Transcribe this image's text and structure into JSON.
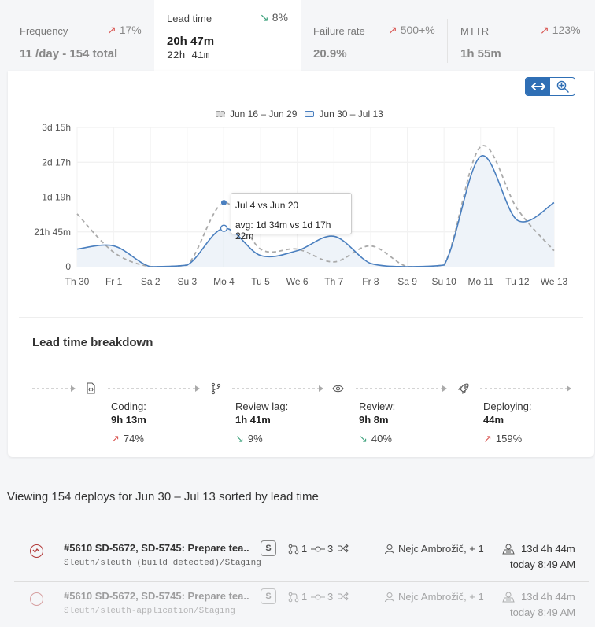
{
  "metrics": [
    {
      "title": "Frequency",
      "delta": "17%",
      "direction": "up",
      "value": "11 /day - 154 total"
    },
    {
      "title": "Lead time",
      "delta": "8%",
      "direction": "down",
      "value": "20h 47m",
      "sub": "22h 41m",
      "active": true
    },
    {
      "title": "Failure rate",
      "delta": "500+%",
      "direction": "up",
      "value": "20.9%"
    },
    {
      "title": "MTTR",
      "delta": "123%",
      "direction": "up",
      "value": "1h 55m"
    }
  ],
  "toolbar": {
    "pan_icon": "arrows-horizontal-icon",
    "zoom_icon": "zoom-in-icon"
  },
  "chart_data": {
    "type": "line",
    "legend_position": "top-center",
    "categories": [
      "Th 30",
      "Fr 1",
      "Sa 2",
      "Su 3",
      "Mo 4",
      "Tu 5",
      "We 6",
      "Th 7",
      "Fr 8",
      "Sa 9",
      "Su 10",
      "Mo 11",
      "Tu 12",
      "We 13"
    ],
    "y_ticks": [
      "0",
      "21h 45m",
      "1d 19h",
      "2d 17h",
      "3d 15h"
    ],
    "y_tick_hours": [
      0,
      21.75,
      43.5,
      65.25,
      87
    ],
    "ylim_hours": [
      0,
      87
    ],
    "grid": true,
    "series": [
      {
        "name": "Jun 16 – Jun 29",
        "style": "dashed",
        "color": "#aaaaaa",
        "values_hours": [
          33,
          9,
          0,
          1,
          40,
          11,
          11,
          3,
          13,
          0,
          1,
          75,
          36,
          10
        ]
      },
      {
        "name": "Jun 30 – Jul 13",
        "style": "solid-area",
        "color": "#4a7fbf",
        "values_hours": [
          11,
          13,
          0,
          1,
          24,
          7,
          10,
          19,
          2,
          0,
          1,
          69,
          29,
          40
        ]
      }
    ],
    "tooltip": {
      "title": "Jul 4 vs Jun 20",
      "text": "avg: 1d 34m vs 1d 17h 22m"
    }
  },
  "breakdown": {
    "title": "Lead time breakdown",
    "stages": [
      {
        "label": "Coding:",
        "value": "9h 13m",
        "delta": "74%",
        "direction": "up",
        "icon": "file-code-icon"
      },
      {
        "label": "Review lag:",
        "value": "1h 41m",
        "delta": "9%",
        "direction": "down",
        "icon": "git-branch-icon"
      },
      {
        "label": "Review:",
        "value": "9h 8m",
        "delta": "40%",
        "direction": "down",
        "icon": "eye-icon"
      },
      {
        "label": "Deploying:",
        "value": "44m",
        "delta": "159%",
        "direction": "up",
        "icon": "rocket-icon"
      }
    ]
  },
  "deploys": {
    "summary": "Viewing 154 deploys for Jun 30 – Jul 13 sorted by lead time",
    "rows": [
      {
        "title": "#5610 SD-5672, SD-5745: Prepare tea...",
        "path": "Sleuth/sleuth (build detected)/Staging",
        "size": "S",
        "prs": "1",
        "commits": "3",
        "author": "Nejc Ambrožič, + 1",
        "duration": "13d 4h 44m",
        "time": "today 8:49 AM"
      },
      {
        "title": "#5610 SD-5672, SD-5745: Prepare tea...",
        "path": "Sleuth/sleuth-application/Staging",
        "size": "S",
        "prs": "1",
        "commits": "3",
        "author": "Nejc Ambrožič, + 1",
        "duration": "13d 4h 44m",
        "time": "today 8:49 AM"
      }
    ]
  }
}
